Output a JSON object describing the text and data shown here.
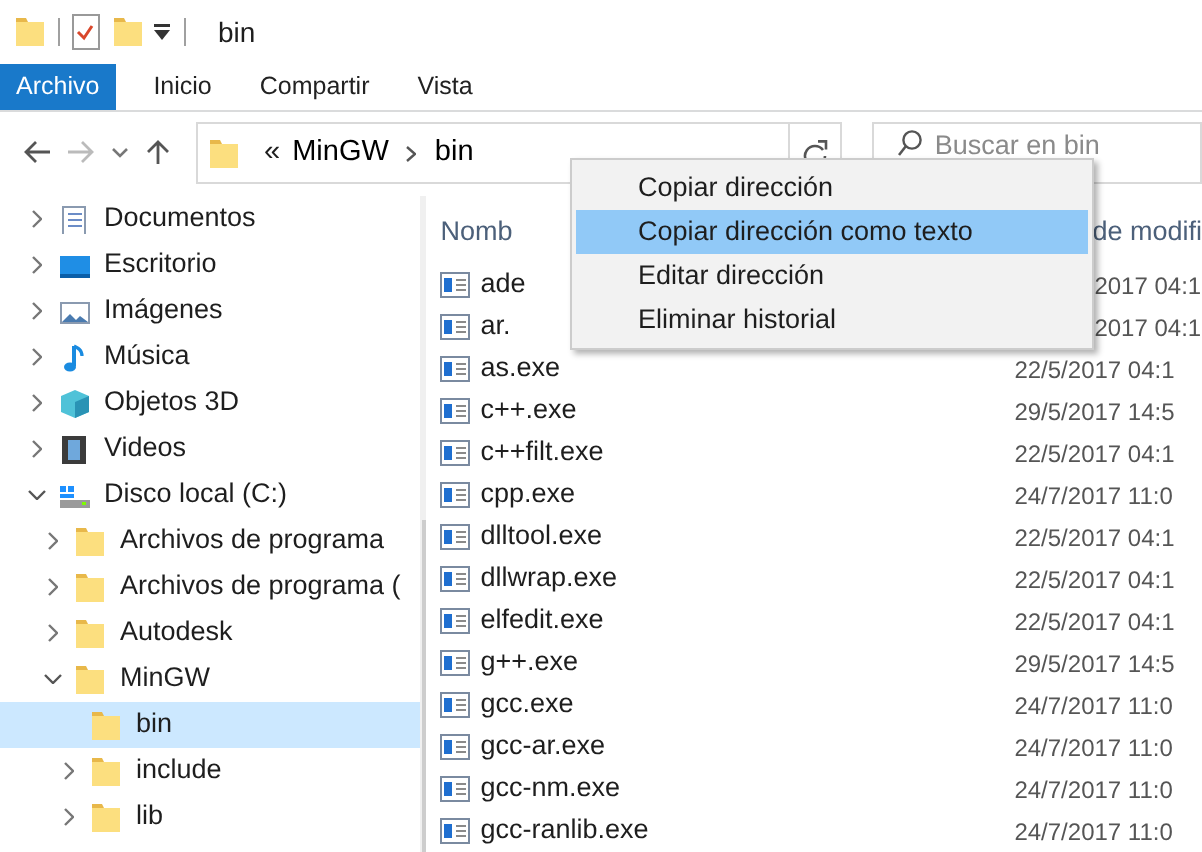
{
  "window": {
    "title": "bin"
  },
  "ribbon_tabs": [
    {
      "label": "Archivo",
      "selected": true
    },
    {
      "label": "Inicio",
      "selected": false
    },
    {
      "label": "Compartir",
      "selected": false
    },
    {
      "label": "Vista",
      "selected": false
    }
  ],
  "address": {
    "overflow": "«",
    "crumbs": [
      "MinGW",
      "bin"
    ]
  },
  "search": {
    "placeholder": "Buscar en bin"
  },
  "nav_tree": [
    {
      "label": "Documentos",
      "kind": "documents",
      "expanded": false,
      "selected": false
    },
    {
      "label": "Escritorio",
      "kind": "desktop",
      "expanded": false,
      "selected": false
    },
    {
      "label": "Imágenes",
      "kind": "pictures",
      "expanded": false,
      "selected": false
    },
    {
      "label": "Música",
      "kind": "music",
      "expanded": false,
      "selected": false
    },
    {
      "label": "Objetos 3D",
      "kind": "objects",
      "expanded": false,
      "selected": false
    },
    {
      "label": "Videos",
      "kind": "videos",
      "expanded": false,
      "selected": false
    },
    {
      "label": "Disco local (C:)",
      "kind": "drive",
      "expanded": true,
      "selected": false,
      "children": [
        {
          "label": "Archivos de programa",
          "kind": "folder",
          "expanded": false,
          "selected": false
        },
        {
          "label": "Archivos de programa (",
          "kind": "folder",
          "expanded": false,
          "selected": false
        },
        {
          "label": "Autodesk",
          "kind": "folder",
          "expanded": false,
          "selected": false
        },
        {
          "label": "MinGW",
          "kind": "folder",
          "expanded": true,
          "selected": false,
          "children": [
            {
              "label": "bin",
              "kind": "folder",
              "leaf": true,
              "selected": true
            },
            {
              "label": "include",
              "kind": "folder",
              "expanded": false,
              "selected": false
            },
            {
              "label": "lib",
              "kind": "folder",
              "expanded": false,
              "selected": false
            }
          ]
        }
      ]
    }
  ],
  "file_list": {
    "columns": [
      "Nomb",
      "de modifi"
    ],
    "rows": [
      {
        "name": "ade",
        "date": "2017 04:1",
        "covered": true
      },
      {
        "name": "ar.",
        "date": "2017 04:1",
        "covered": true
      },
      {
        "name": "as.exe",
        "date": "22/5/2017 04:1",
        "covered": false
      },
      {
        "name": "c++.exe",
        "date": "29/5/2017 14:5",
        "covered": false
      },
      {
        "name": "c++filt.exe",
        "date": "22/5/2017 04:1",
        "covered": false
      },
      {
        "name": "cpp.exe",
        "date": "24/7/2017 11:0",
        "covered": false
      },
      {
        "name": "dlltool.exe",
        "date": "22/5/2017 04:1",
        "covered": false
      },
      {
        "name": "dllwrap.exe",
        "date": "22/5/2017 04:1",
        "covered": false
      },
      {
        "name": "elfedit.exe",
        "date": "22/5/2017 04:1",
        "covered": false
      },
      {
        "name": "g++.exe",
        "date": "29/5/2017 14:5",
        "covered": false
      },
      {
        "name": "gcc.exe",
        "date": "24/7/2017 11:0",
        "covered": false
      },
      {
        "name": "gcc-ar.exe",
        "date": "24/7/2017 11:0",
        "covered": false
      },
      {
        "name": "gcc-nm.exe",
        "date": "24/7/2017 11:0",
        "covered": false
      },
      {
        "name": "gcc-ranlib.exe",
        "date": "24/7/2017 11:0",
        "covered": false
      }
    ]
  },
  "context_menu": [
    {
      "label": "Copiar dirección",
      "selected": false
    },
    {
      "label": "Copiar dirección como texto",
      "selected": true
    },
    {
      "label": "Editar dirección",
      "selected": false
    },
    {
      "label": "Eliminar historial",
      "selected": false
    }
  ]
}
